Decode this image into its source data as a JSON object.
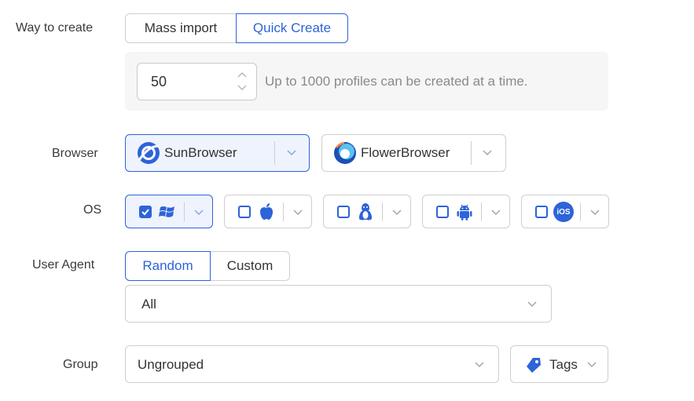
{
  "labels": {
    "way_to_create": "Way to create",
    "browser": "Browser",
    "os": "OS",
    "user_agent": "User Agent",
    "group": "Group"
  },
  "way_to_create": {
    "options": [
      "Mass import",
      "Quick Create"
    ],
    "selected": "Quick Create"
  },
  "quick_create": {
    "count": "50",
    "hint": "Up to 1000 profiles can be created at a time."
  },
  "browsers": [
    {
      "name": "SunBrowser",
      "selected": true,
      "icon": "sunbrowser-icon"
    },
    {
      "name": "FlowerBrowser",
      "selected": false,
      "icon": "flowerbrowser-icon"
    }
  ],
  "os_options": [
    {
      "icon": "windows-icon",
      "checked": true
    },
    {
      "icon": "apple-icon",
      "checked": false
    },
    {
      "icon": "linux-icon",
      "checked": false
    },
    {
      "icon": "android-icon",
      "checked": false
    },
    {
      "icon": "ios-icon",
      "label": "iOS",
      "checked": false
    }
  ],
  "user_agent": {
    "options": [
      "Random",
      "Custom"
    ],
    "selected": "Random",
    "value": "All"
  },
  "group": {
    "value": "Ungrouped",
    "tags_label": "Tags"
  },
  "colors": {
    "accent": "#2e63d9",
    "border": "#cfcfcf",
    "panel_bg": "#f6f6f6",
    "selected_bg": "#eef3fd"
  }
}
